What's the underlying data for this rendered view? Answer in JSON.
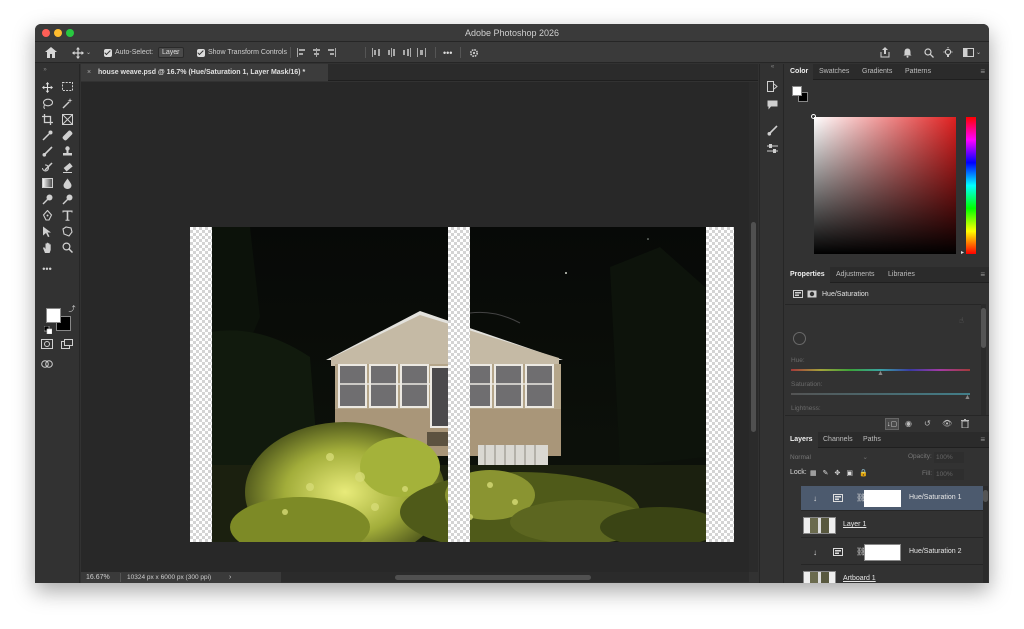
{
  "window": {
    "title": "Adobe Photoshop 2026"
  },
  "options_bar": {
    "home_icon": "home-icon",
    "move_icon": "move-tool-icon",
    "auto_select_label": "Auto-Select:",
    "auto_select_value": "Layer",
    "show_transform_label": "Show Transform Controls",
    "more_label": "•••",
    "gear_icon": "gear-icon"
  },
  "document": {
    "tab_title": "house weave.psd @ 16.7% (Hue/Saturation 1, Layer Mask/16) *",
    "tab_close": "×",
    "zoom": "16.67%",
    "doc_info": "10324 px x 6000 px (300 ppi)",
    "status_arrow": "›"
  },
  "color_panel": {
    "tabs": [
      "Color",
      "Swatches",
      "Gradients",
      "Patterns"
    ],
    "base_hue_color": "#e02020"
  },
  "properties_panel": {
    "tabs": [
      "Properties",
      "Adjustments",
      "Libraries"
    ],
    "adjustment_label": "Hue/Saturation",
    "hue_label": "Hue:",
    "saturation_label": "Saturation:",
    "lightness_label": "Lightness:"
  },
  "layers_panel": {
    "tabs": [
      "Layers",
      "Channels",
      "Paths"
    ],
    "blend_mode": "Normal",
    "opacity_label": "Opacity:",
    "opacity_value": "100%",
    "lock_label": "Lock:",
    "fill_label": "Fill:",
    "fill_value": "100%",
    "layers": [
      {
        "name": "Hue/Saturation 1",
        "type": "adjustment",
        "selected": true
      },
      {
        "name": "Layer 1",
        "type": "pixel",
        "selected": false
      },
      {
        "name": "Hue/Saturation 2",
        "type": "adjustment",
        "selected": false
      },
      {
        "name": "Artboard 1",
        "type": "artboard",
        "selected": false
      }
    ]
  },
  "colors": {
    "accent_selection": "#4c5a6e",
    "panel_bg": "#323232",
    "canvas_bg": "#282828"
  }
}
